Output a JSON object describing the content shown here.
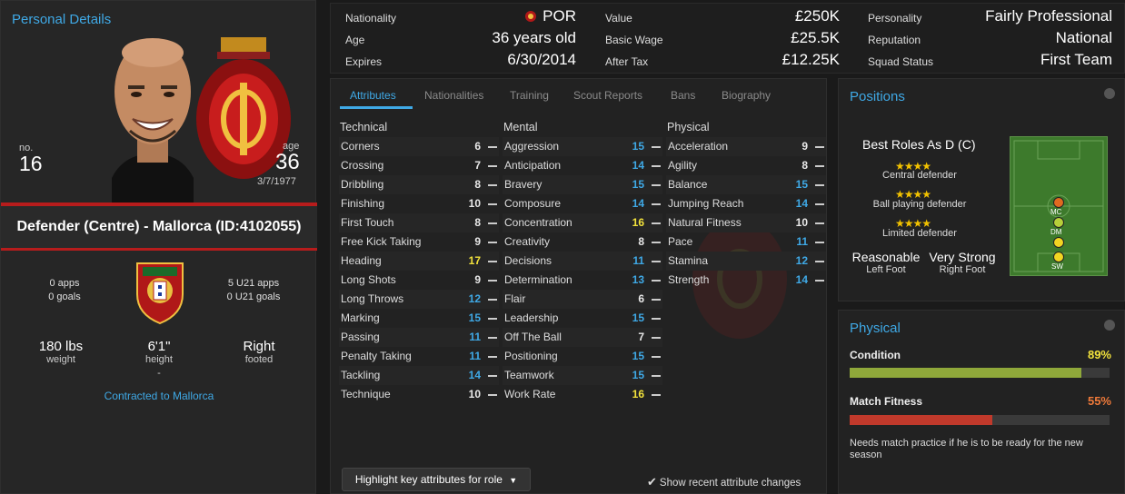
{
  "personal": {
    "title": "Personal Details",
    "no_label": "no.",
    "no": "16",
    "age_label": "age",
    "age": "36",
    "dob": "3/7/1977",
    "position_line": "Defender (Centre) - Mallorca (ID:4102055)",
    "apps": "0 apps",
    "goals": "0 goals",
    "u21_apps": "5 U21 apps",
    "u21_goals": "0 U21 goals",
    "weight_val": "180 lbs",
    "weight_label": "weight",
    "height_val": "6'1\"",
    "height_label": "height",
    "foot_val": "Right",
    "foot_label": "footed",
    "dash": "-",
    "contracted": "Contracted to Mallorca"
  },
  "summary": {
    "nationality_label": "Nationality",
    "nationality": "POR",
    "age_label": "Age",
    "age": "36 years old",
    "expires_label": "Expires",
    "expires": "6/30/2014",
    "value_label": "Value",
    "value": "£250K",
    "wage_label": "Basic Wage",
    "wage": "£25.5K",
    "aftertax_label": "After Tax",
    "aftertax": "£12.25K",
    "personality_label": "Personality",
    "personality": "Fairly Professional",
    "reputation_label": "Reputation",
    "reputation": "National",
    "squad_label": "Squad Status",
    "squad": "First Team"
  },
  "tabs": [
    "Attributes",
    "Nationalities",
    "Training",
    "Scout Reports",
    "Bans",
    "Biography"
  ],
  "columns": {
    "technical": "Technical",
    "mental": "Mental",
    "physical": "Physical"
  },
  "technical": [
    {
      "name": "Corners",
      "value": "6",
      "color": "white"
    },
    {
      "name": "Crossing",
      "value": "7",
      "color": "white"
    },
    {
      "name": "Dribbling",
      "value": "8",
      "color": "white"
    },
    {
      "name": "Finishing",
      "value": "10",
      "color": "white"
    },
    {
      "name": "First Touch",
      "value": "8",
      "color": "white"
    },
    {
      "name": "Free Kick Taking",
      "value": "9",
      "color": "white"
    },
    {
      "name": "Heading",
      "value": "17",
      "color": "yellow"
    },
    {
      "name": "Long Shots",
      "value": "9",
      "color": "white"
    },
    {
      "name": "Long Throws",
      "value": "12",
      "color": "blue"
    },
    {
      "name": "Marking",
      "value": "15",
      "color": "blue"
    },
    {
      "name": "Passing",
      "value": "11",
      "color": "blue"
    },
    {
      "name": "Penalty Taking",
      "value": "11",
      "color": "blue"
    },
    {
      "name": "Tackling",
      "value": "14",
      "color": "blue"
    },
    {
      "name": "Technique",
      "value": "10",
      "color": "white"
    }
  ],
  "mental": [
    {
      "name": "Aggression",
      "value": "15",
      "color": "blue"
    },
    {
      "name": "Anticipation",
      "value": "14",
      "color": "blue"
    },
    {
      "name": "Bravery",
      "value": "15",
      "color": "blue"
    },
    {
      "name": "Composure",
      "value": "14",
      "color": "blue"
    },
    {
      "name": "Concentration",
      "value": "16",
      "color": "yellow"
    },
    {
      "name": "Creativity",
      "value": "8",
      "color": "white"
    },
    {
      "name": "Decisions",
      "value": "11",
      "color": "blue"
    },
    {
      "name": "Determination",
      "value": "13",
      "color": "blue"
    },
    {
      "name": "Flair",
      "value": "6",
      "color": "white"
    },
    {
      "name": "Leadership",
      "value": "15",
      "color": "blue"
    },
    {
      "name": "Off The Ball",
      "value": "7",
      "color": "white"
    },
    {
      "name": "Positioning",
      "value": "15",
      "color": "blue"
    },
    {
      "name": "Teamwork",
      "value": "15",
      "color": "blue"
    },
    {
      "name": "Work Rate",
      "value": "16",
      "color": "yellow"
    }
  ],
  "physical": [
    {
      "name": "Acceleration",
      "value": "9",
      "color": "white"
    },
    {
      "name": "Agility",
      "value": "8",
      "color": "white"
    },
    {
      "name": "Balance",
      "value": "15",
      "color": "blue"
    },
    {
      "name": "Jumping Reach",
      "value": "14",
      "color": "blue"
    },
    {
      "name": "Natural Fitness",
      "value": "10",
      "color": "white"
    },
    {
      "name": "Pace",
      "value": "11",
      "color": "blue"
    },
    {
      "name": "Stamina",
      "value": "12",
      "color": "blue"
    },
    {
      "name": "Strength",
      "value": "14",
      "color": "blue"
    }
  ],
  "highlight_button": "Highlight key attributes for role",
  "show_recent": "Show recent attribute changes",
  "positions": {
    "title": "Positions",
    "best_roles": "Best Roles As D (C)",
    "roles": [
      "Central defender",
      "Ball playing defender",
      "Limited defender"
    ],
    "left_foot_val": "Reasonable",
    "left_foot_label": "Left Foot",
    "right_foot_val": "Very Strong",
    "right_foot_label": "Right Foot",
    "pitch_labels": [
      "MC",
      "DM",
      "SW"
    ]
  },
  "physical_panel": {
    "title": "Physical",
    "condition_label": "Condition",
    "condition": "89%",
    "condition_fraction": 0.89,
    "fitness_label": "Match Fitness",
    "fitness": "55%",
    "fitness_fraction": 0.55,
    "note": "Needs match practice if he is to be ready for the new season"
  },
  "colors": {
    "accent": "#3fa9e6",
    "red": "#b71c1c",
    "yellow": "#f2e23c",
    "green_bar": "#8fa83a",
    "red_bar": "#c0392b"
  }
}
